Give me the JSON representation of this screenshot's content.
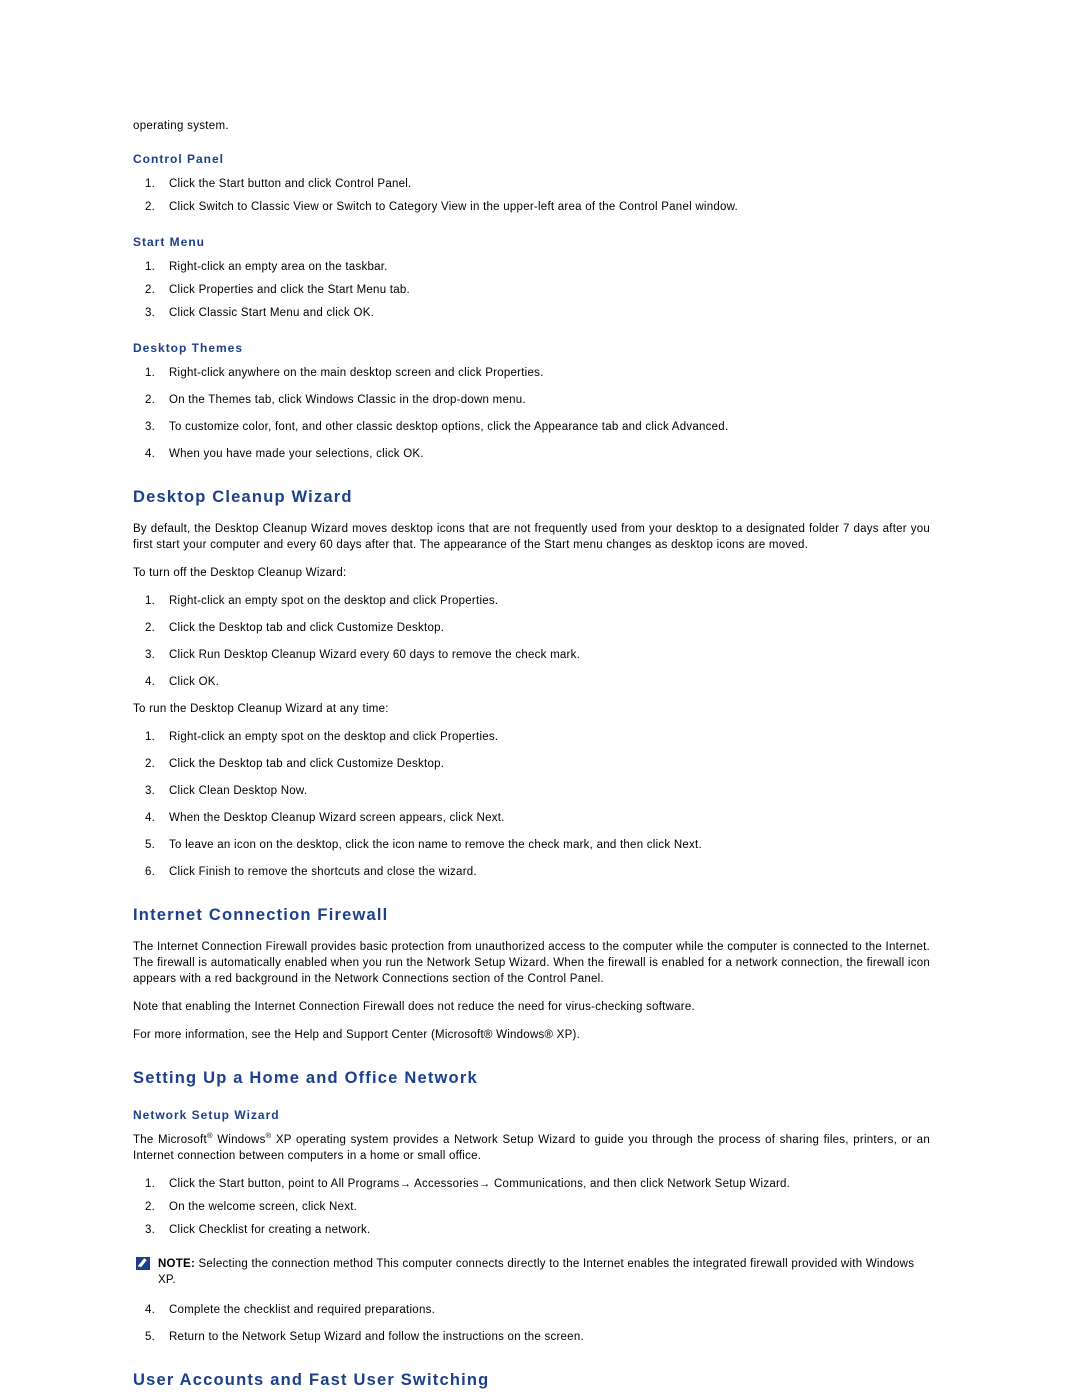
{
  "page": {
    "intro_line": "operating system.",
    "sections": [
      {
        "id": "control-panel",
        "heading": "Control Panel",
        "level": "sub",
        "steps": [
          "Click the Start button and click Control Panel.",
          "Click Switch to Classic View or Switch to Category View in the upper-left area of the Control Panel window."
        ]
      },
      {
        "id": "start-menu",
        "heading": "Start Menu",
        "level": "sub",
        "steps": [
          "Right-click an empty area on the taskbar.",
          "Click Properties and click the Start Menu tab.",
          "Click Classic Start Menu and click OK."
        ]
      },
      {
        "id": "desktop-themes",
        "heading": "Desktop Themes",
        "level": "sub",
        "steps": [
          "Right-click anywhere on the main desktop screen and click Properties.",
          "On the Themes tab, click Windows Classic in the drop-down menu.",
          "To customize color, font, and other classic desktop options, click the Appearance tab and click Advanced.",
          "When you have made your selections, click OK."
        ]
      },
      {
        "id": "desktop-cleanup-wizard",
        "heading": "Desktop Cleanup Wizard",
        "level": "section",
        "paragraph": "By default, the Desktop Cleanup Wizard moves desktop icons that are not frequently used from your desktop to a designated folder 7 days after you first start your computer and every 60 days after that. The appearance of the Start menu changes as desktop icons are moved.",
        "lead_1": "To turn off the Desktop Cleanup Wizard:",
        "steps_1": [
          "Right-click an empty spot on the desktop and click Properties.",
          "Click the Desktop tab and click Customize Desktop.",
          "Click Run Desktop Cleanup Wizard every 60 days to remove the check mark.",
          "Click OK."
        ],
        "lead_2": "To run the Desktop Cleanup Wizard at any time:",
        "steps_2": [
          "Right-click an empty spot on the desktop and click Properties.",
          "Click the Desktop tab and click Customize Desktop.",
          "Click Clean Desktop Now.",
          "When the Desktop Cleanup Wizard screen appears, click Next.",
          "To leave an icon on the desktop, click the icon name to remove the check mark, and then click Next.",
          "Click Finish to remove the shortcuts and close the wizard."
        ]
      },
      {
        "id": "internet-connection-firewall",
        "heading": "Internet Connection Firewall",
        "level": "section",
        "paragraph_1": "The Internet Connection Firewall provides basic protection from unauthorized access to the computer while the computer is connected to the Internet. The firewall is automatically enabled when you run the Network Setup Wizard. When the firewall is enabled for a network connection, the firewall icon appears with a red background in the Network Connections section of the Control Panel.",
        "paragraph_2": "Note that enabling the Internet Connection Firewall does not reduce the need for virus-checking software.",
        "paragraph_3": "For more information, see the Help and Support Center (Microsoft® Windows® XP)."
      },
      {
        "id": "setting-up-a-home-and-office-network",
        "heading": "Setting Up a Home and Office Network",
        "level": "section",
        "subheading": "Network Setup Wizard",
        "paragraph_prefix": "The Microsoft",
        "paragraph_mid": " Windows",
        "paragraph_suffix": " XP operating system provides a Network Setup Wizard to guide you through the process of sharing files, printers, or an Internet connection between computers in a home or small office.",
        "registered_mark": "®",
        "steps_1": [
          "Click the Start button, point to All Programs→ Accessories→ Communications, and then click Network Setup Wizard.",
          "On the welcome screen, click Next.",
          "Click Checklist for creating a network."
        ],
        "note_label": "NOTE:",
        "note_text": " Selecting the connection method This computer connects directly to the Internet enables the integrated firewall provided with Windows XP.",
        "steps_2": [
          "Complete the checklist and required preparations.",
          "Return to the Network Setup Wizard and follow the instructions on the screen."
        ]
      },
      {
        "id": "user-accounts-and-fast-user-switching",
        "heading": "User Accounts and Fast User Switching",
        "level": "section"
      }
    ]
  },
  "colors": {
    "heading": "#1b3f8b",
    "text": "#000000",
    "note_icon": "#1b3f8b"
  }
}
